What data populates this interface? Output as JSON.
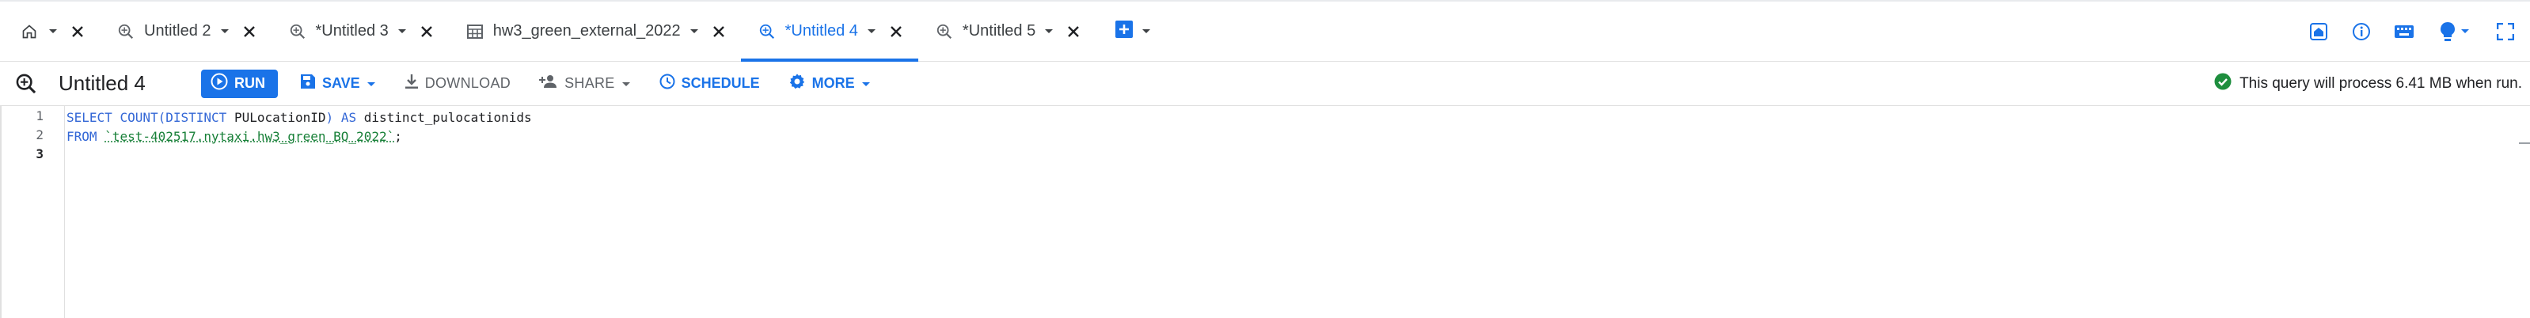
{
  "tabs": [
    {
      "icon": "home-icon",
      "label": "",
      "active": false
    },
    {
      "icon": "query-icon",
      "label": "Untitled 2",
      "active": false
    },
    {
      "icon": "query-icon",
      "label": "*Untitled 3",
      "active": false
    },
    {
      "icon": "table-icon",
      "label": "hw3_green_external_2022",
      "active": false
    },
    {
      "icon": "query-icon",
      "label": "*Untitled 4",
      "active": true
    },
    {
      "icon": "query-icon",
      "label": "*Untitled 5",
      "active": false
    }
  ],
  "toolbar": {
    "query_title": "Untitled 4",
    "run_label": "RUN",
    "save_label": "SAVE",
    "download_label": "DOWNLOAD",
    "share_label": "SHARE",
    "schedule_label": "SCHEDULE",
    "more_label": "MORE",
    "status_text": "This query will process 6.41 MB when run."
  },
  "editor": {
    "line_numbers": [
      "1",
      "2",
      "3"
    ],
    "line1": {
      "kw1": "SELECT",
      "fn1": "COUNT",
      "p1": "(",
      "kw2": "DISTINCT",
      "col": " PULocationID",
      "p2": ")",
      "kw3": "AS",
      "alias": "distinct_pulocationids"
    },
    "line2": {
      "kw1": "FROM",
      "table": "`test-402517.nytaxi.hw3_green_BQ_2022`",
      "semi": ";"
    }
  },
  "colors": {
    "accent": "#1a73e8",
    "keyword": "#3367d6",
    "string": "#188038",
    "success": "#1e8e3e"
  }
}
